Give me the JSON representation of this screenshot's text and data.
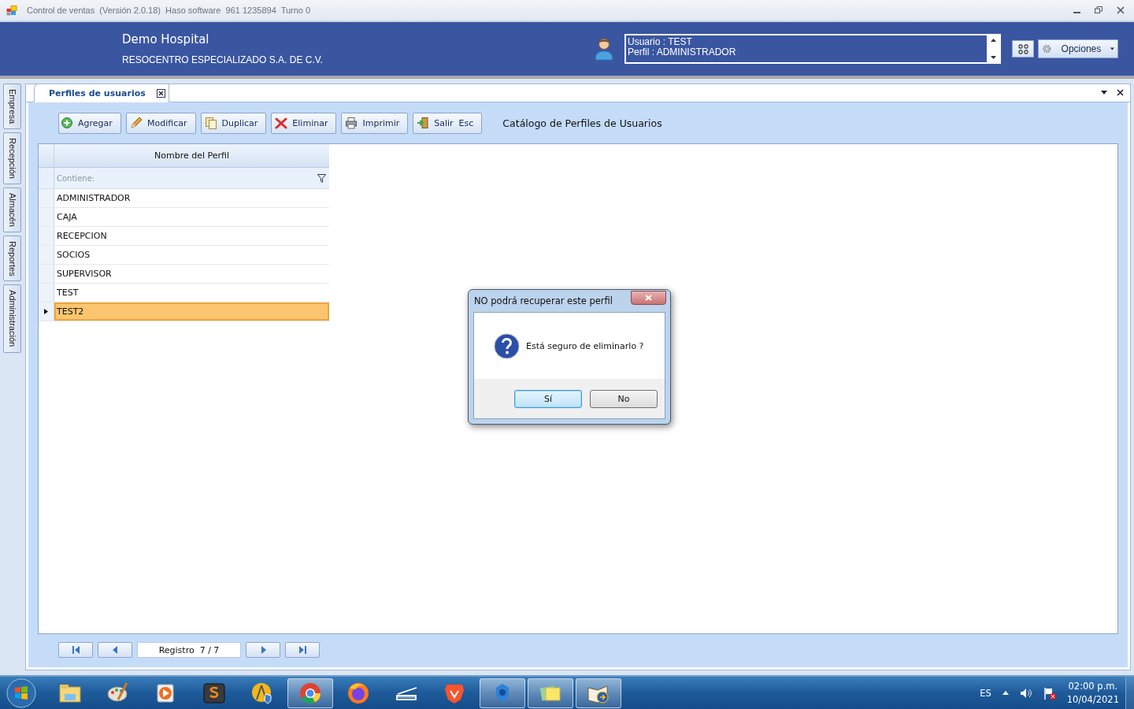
{
  "window": {
    "title": "Control de ventas  (Versión 2.0.18)  Haso software  961 1235894  Turno 0"
  },
  "header": {
    "company": "Demo Hospital",
    "subtitle": "RESOCENTRO ESPECIALIZADO S.A. DE C.V.",
    "user_info": [
      "Usuario : TEST",
      "Perfil : ADMINISTRADOR"
    ],
    "options_button": "Opciones"
  },
  "side_tabs": [
    {
      "label": "Empresa"
    },
    {
      "label": "Recepción"
    },
    {
      "label": "Almacén"
    },
    {
      "label": "Reportes"
    },
    {
      "label": "Administración"
    }
  ],
  "document_tabs": [
    {
      "label": "Perfiles de usuarios",
      "selected": true
    }
  ],
  "toolbar": [
    {
      "label": "Agregar",
      "kind": "add"
    },
    {
      "label": "Modificar",
      "kind": "edit"
    },
    {
      "label": "Duplicar",
      "kind": "copy"
    },
    {
      "label": "Eliminar",
      "kind": "delete"
    },
    {
      "label": "Imprimir",
      "kind": "print"
    },
    {
      "label": "Salir  Esc",
      "kind": "exit"
    }
  ],
  "heading": "Catálogo de Perfiles de Usuarios",
  "table": {
    "columns": [
      "Nombre del Perfil"
    ],
    "filter_placeholder": "Contiene:",
    "rows": [
      {
        "name": "ADMINISTRADOR",
        "selected": false
      },
      {
        "name": "CAJA",
        "selected": false
      },
      {
        "name": "RECEPCION",
        "selected": false
      },
      {
        "name": "SOCIOS",
        "selected": false
      },
      {
        "name": "SUPERVISOR",
        "selected": false
      },
      {
        "name": "TEST",
        "selected": false
      },
      {
        "name": "TEST2",
        "selected": true
      }
    ]
  },
  "navigator": {
    "record": "Registro  7 / 7"
  },
  "dialog": {
    "title": "NO podrá recuperar este perfil",
    "message": "Está seguro de eliminarlo ?",
    "buttons": [
      {
        "label": "Sí",
        "selected": true
      },
      {
        "label": "No",
        "selected": false
      }
    ]
  },
  "taskbar": {
    "apps": [
      {
        "kind": "folder",
        "active": false
      },
      {
        "kind": "paint",
        "active": false
      },
      {
        "kind": "media",
        "active": false
      },
      {
        "kind": "editor",
        "active": false
      },
      {
        "kind": "compass",
        "active": false
      },
      {
        "kind": "chrome",
        "active": true
      },
      {
        "kind": "firefox",
        "active": false
      },
      {
        "kind": "scanner",
        "active": false
      },
      {
        "kind": "lion",
        "active": false
      },
      {
        "kind": "gear",
        "active": true
      },
      {
        "kind": "notes",
        "active": true
      },
      {
        "kind": "book",
        "active": true
      }
    ],
    "language": "ES",
    "time": "02:00 p.m.",
    "date": "10/04/2021"
  }
}
